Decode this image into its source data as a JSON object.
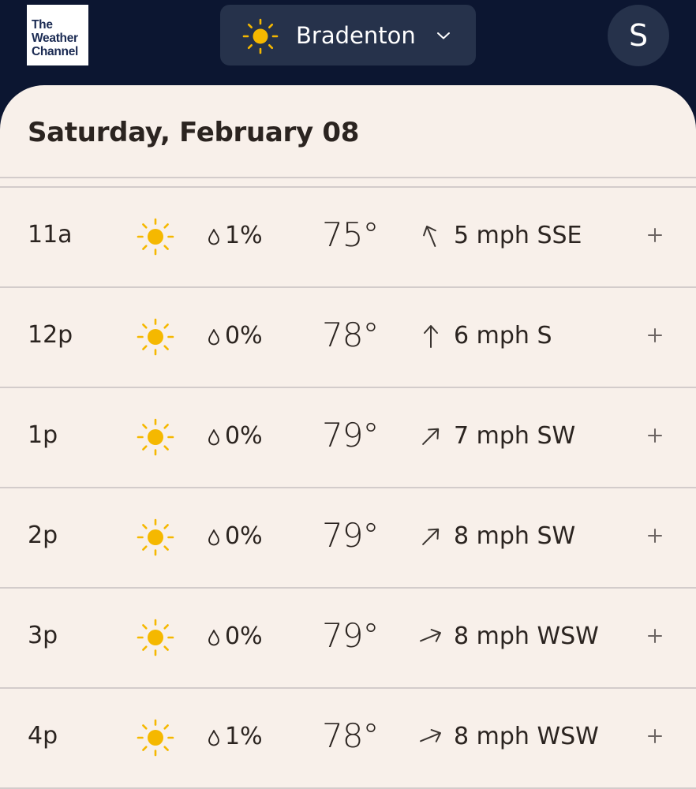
{
  "header": {
    "logo_lines": [
      "The",
      "Weather",
      "Channel"
    ],
    "location": "Bradenton",
    "avatar_letter": "S"
  },
  "panel": {
    "day_title": "Saturday, February 08"
  },
  "colors": {
    "header_bg": "#0c1631",
    "pill_bg": "#26324b",
    "panel_bg": "#f8f0ea",
    "sun": "#f5b800",
    "text": "#2b2420"
  },
  "icons": {
    "weather": "sun-icon",
    "precip": "raindrop-icon",
    "wind": "wind-direction-arrow-icon",
    "expand": "plus-icon",
    "dropdown": "chevron-down-icon"
  },
  "hourly": [
    {
      "time": "11a",
      "precip": "1%",
      "temp": "75°",
      "wind": "5 mph SSE",
      "wind_dir_deg": 337.5
    },
    {
      "time": "12p",
      "precip": "0%",
      "temp": "78°",
      "wind": "6 mph S",
      "wind_dir_deg": 0
    },
    {
      "time": "1p",
      "precip": "0%",
      "temp": "79°",
      "wind": "7 mph SW",
      "wind_dir_deg": 45
    },
    {
      "time": "2p",
      "precip": "0%",
      "temp": "79°",
      "wind": "8 mph SW",
      "wind_dir_deg": 45
    },
    {
      "time": "3p",
      "precip": "0%",
      "temp": "79°",
      "wind": "8 mph WSW",
      "wind_dir_deg": 67.5
    },
    {
      "time": "4p",
      "precip": "1%",
      "temp": "78°",
      "wind": "8 mph WSW",
      "wind_dir_deg": 67.5
    }
  ]
}
